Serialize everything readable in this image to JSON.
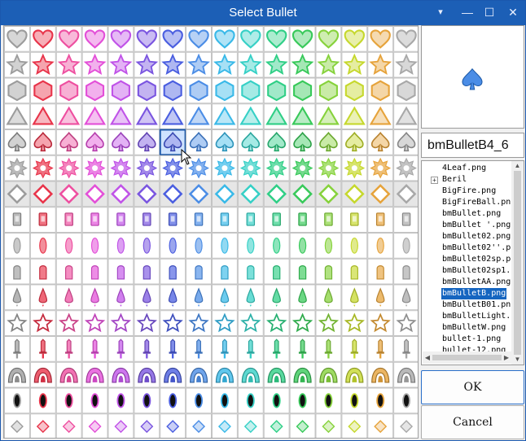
{
  "window": {
    "title": "Select Bullet"
  },
  "titlebar_controls": {
    "menu": "▾",
    "minimize": "—",
    "maximize": "☐",
    "close": "✕"
  },
  "grid": {
    "columns": 16,
    "rows": [
      "heart",
      "star",
      "hexagon",
      "triangle",
      "spade",
      "sun",
      "diamond",
      "card",
      "ellipse",
      "capsule",
      "droplet",
      "outline-star",
      "knife",
      "arch",
      "dark-oval",
      "small-diamond"
    ],
    "palette": [
      "#9c9c9c",
      "#e8344a",
      "#ee4fa0",
      "#e34fd8",
      "#c053e8",
      "#7a55e0",
      "#4a5ee0",
      "#4b8de6",
      "#39b9e8",
      "#36d0c6",
      "#2fcf86",
      "#38c95a",
      "#86d23b",
      "#c6d82d",
      "#e6a33b",
      "#a8a8a8"
    ],
    "selected": {
      "row": 4,
      "col": 6
    }
  },
  "preview": {
    "icon": "spade-icon",
    "color": "#4b8de6"
  },
  "selected_name": "bmBulletB4_6",
  "tree": {
    "items": [
      {
        "label": "4Leaf.png",
        "expander": false
      },
      {
        "label": "Beril",
        "expander": true
      },
      {
        "label": "BigFire.png",
        "expander": false
      },
      {
        "label": "BigFireBall.pn",
        "expander": false
      },
      {
        "label": "bmBullet.png",
        "expander": false
      },
      {
        "label": "bmBullet '.png",
        "expander": false
      },
      {
        "label": "bmBullet02.png",
        "expander": false
      },
      {
        "label": "bmBullet02''.p",
        "expander": false
      },
      {
        "label": "bmBullet02sp.p",
        "expander": false
      },
      {
        "label": "bmBullet02sp1.",
        "expander": false
      },
      {
        "label": "bmBulletAA.png",
        "expander": false
      },
      {
        "label": "bmBulletB.png",
        "expander": false
      },
      {
        "label": "bmBulletB01.pn",
        "expander": false
      },
      {
        "label": "bmBulletLight.",
        "expander": false
      },
      {
        "label": "bmBulletW.png",
        "expander": false
      },
      {
        "label": "bullet-1.png",
        "expander": false
      },
      {
        "label": "bullet-12.png",
        "expander": false
      }
    ],
    "selected_index": 11,
    "expander_symbol": "+"
  },
  "buttons": {
    "ok": "OK",
    "cancel": "Cancel"
  }
}
